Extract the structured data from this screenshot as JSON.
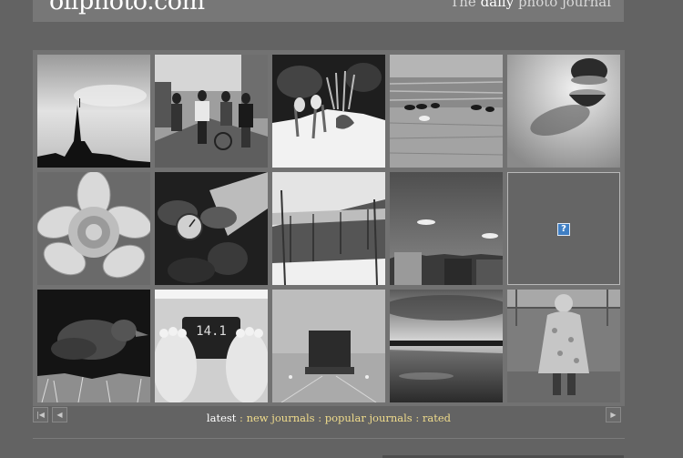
{
  "header": {
    "logo_text": "ollphoto.com",
    "tagline_prefix": "The ",
    "tagline_accent": "daily",
    "tagline_suffix": " photo journal"
  },
  "gallery": {
    "rows": [
      [
        {
          "subject": "church-steeple-silhouette-photo"
        },
        {
          "subject": "people-walking-street-photo"
        },
        {
          "subject": "snowdrops-in-snow-photo"
        },
        {
          "subject": "geese-on-shore-photo"
        },
        {
          "subject": "sliced-fruit-photo"
        }
      ],
      [
        {
          "subject": "water-lily-photo"
        },
        {
          "subject": "clock-and-hands-photo"
        },
        {
          "subject": "bridge-in-winter-photo"
        },
        {
          "subject": "building-under-sky-photo"
        },
        {
          "subject": "missing-image",
          "missing": true,
          "icon_text": "?"
        }
      ],
      [
        {
          "subject": "bird-on-ground-photo"
        },
        {
          "subject": "feet-on-scale-photo",
          "readout": "14.1"
        },
        {
          "subject": "truck-in-fog-photo"
        },
        {
          "subject": "lake-at-dusk-photo"
        },
        {
          "subject": "child-in-raincoat-photo"
        }
      ]
    ]
  },
  "nav": {
    "first_icon": "|◀",
    "prev_icon": "◀",
    "next_icon": "▶",
    "current": "latest",
    "sep": " : ",
    "links": [
      "new journals",
      "popular journals",
      "rated"
    ]
  }
}
